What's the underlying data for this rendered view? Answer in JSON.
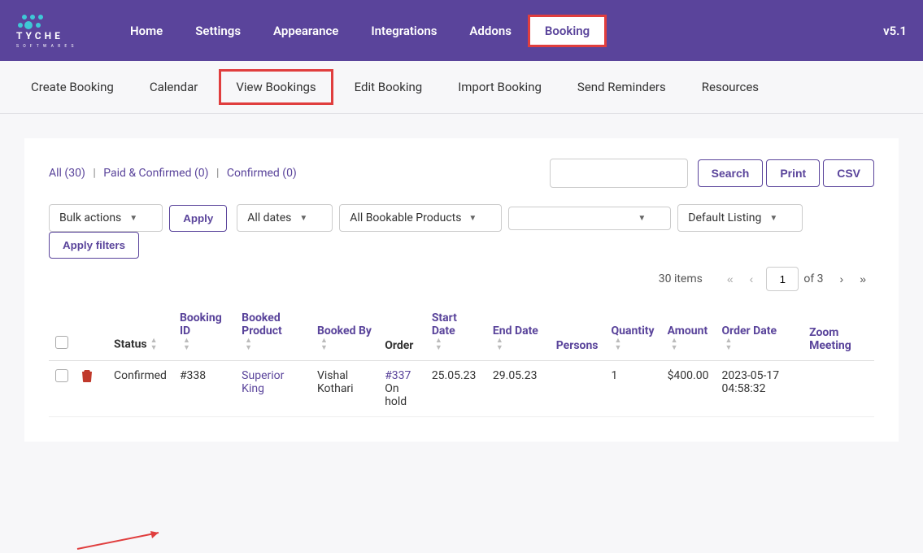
{
  "brand": "TYCHE SOFTWARES",
  "version": "v5.1",
  "nav": {
    "home": "Home",
    "settings": "Settings",
    "appearance": "Appearance",
    "integrations": "Integrations",
    "addons": "Addons",
    "booking": "Booking"
  },
  "subnav": {
    "create": "Create Booking",
    "calendar": "Calendar",
    "view": "View Bookings",
    "edit": "Edit Booking",
    "import": "Import Booking",
    "reminders": "Send Reminders",
    "resources": "Resources"
  },
  "filters": {
    "all": "All (30)",
    "paid": "Paid & Confirmed (0)",
    "confirmed": "Confirmed (0)"
  },
  "buttons": {
    "search": "Search",
    "print": "Print",
    "csv": "CSV",
    "apply": "Apply",
    "apply_filters": "Apply filters"
  },
  "selects": {
    "bulk": "Bulk actions",
    "dates": "All dates",
    "products": "All Bookable Products",
    "empty": "",
    "listing": "Default Listing"
  },
  "pager": {
    "items": "30 items",
    "page": "1",
    "of": "of 3"
  },
  "columns": {
    "status": "Status",
    "booking_id": "Booking ID",
    "booked_product": "Booked Product",
    "booked_by": "Booked By",
    "order": "Order",
    "start_date": "Start Date",
    "end_date": "End Date",
    "persons": "Persons",
    "quantity": "Quantity",
    "amount": "Amount",
    "order_date": "Order Date",
    "zoom": "Zoom Meeting"
  },
  "rows": [
    {
      "status": "Confirmed",
      "booking_id": "#338",
      "booked_product": "Superior King",
      "booked_by": "Vishal Kothari",
      "order_id": "#337",
      "order_status": "On hold",
      "start_date": "25.05.23",
      "end_date": "29.05.23",
      "persons": "",
      "quantity": "1",
      "amount": "$400.00",
      "order_date": "2023-05-17 04:58:32",
      "zoom": ""
    }
  ]
}
